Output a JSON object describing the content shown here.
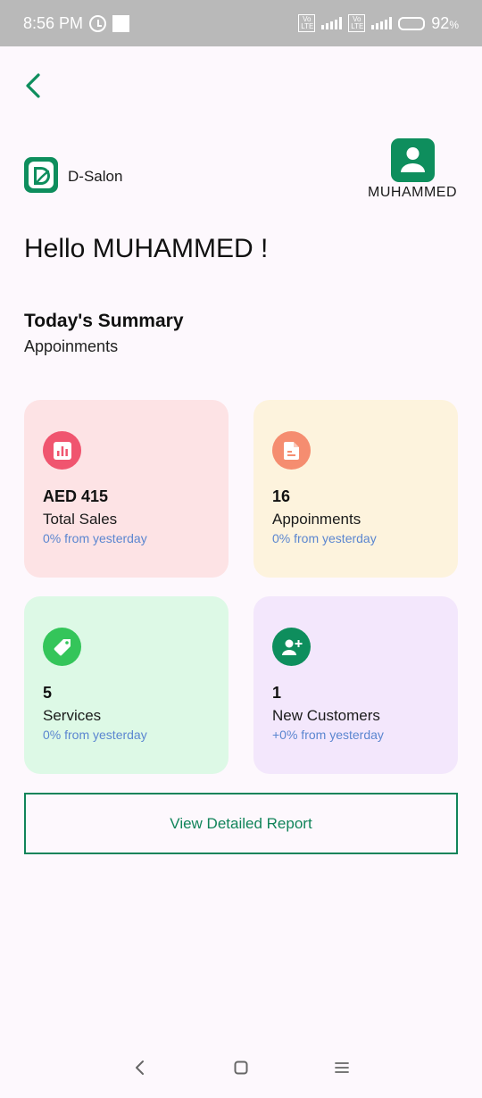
{
  "status_bar": {
    "time": "8:56 PM",
    "battery": "92",
    "battery_unit": "%"
  },
  "brand": {
    "name": "D-Salon"
  },
  "profile": {
    "name": "MUHAMMED"
  },
  "greeting": "Hello MUHAMMED !",
  "summary": {
    "title": "Today's Summary",
    "subtitle": "Appoinments"
  },
  "cards": [
    {
      "value": "AED 415",
      "label": "Total Sales",
      "change": "0% from yesterday",
      "bg": "#fde3e5",
      "icon_bg": "#f0556f",
      "icon": "bar-chart-icon"
    },
    {
      "value": "16",
      "label": "Appoinments",
      "change": "0% from yesterday",
      "bg": "#fdf3dd",
      "icon_bg": "#f58d70",
      "icon": "document-icon"
    },
    {
      "value": "5",
      "label": "Services",
      "change": "0% from yesterday",
      "bg": "#ddf9e6",
      "icon_bg": "#34c55a",
      "icon": "tag-icon"
    },
    {
      "value": "1",
      "label": "New Customers",
      "change": "+0% from yesterday",
      "bg": "#f3e7fc",
      "icon_bg": "#0e8e5d",
      "icon": "add-user-icon"
    }
  ],
  "report_button": "View Detailed Report",
  "colors": {
    "primary": "#0e8e5d",
    "background": "#fdf8fd",
    "change_text": "#5b86d0"
  }
}
